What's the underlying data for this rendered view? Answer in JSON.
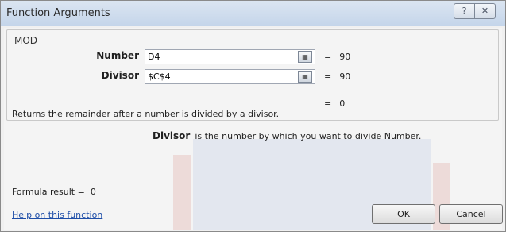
{
  "window": {
    "title": "Function Arguments",
    "help_glyph": "?",
    "close_glyph": "✕"
  },
  "function": {
    "name": "MOD",
    "args": [
      {
        "label": "Number",
        "value": "D4",
        "result_eq": "=",
        "result": "90"
      },
      {
        "label": "Divisor",
        "value": "$C$4",
        "result_eq": "=",
        "result": "90"
      }
    ],
    "overall_eq": "=",
    "overall_result": "0",
    "description": "Returns the remainder after a number is divided by a divisor.",
    "arg_desc_name": "Divisor",
    "arg_desc_text": "is the number by which you want to divide Number."
  },
  "footer": {
    "formula_result_label": "Formula result =",
    "formula_result_value": "0",
    "help_link": "Help on this function",
    "ok_label": "OK",
    "cancel_label": "Cancel"
  },
  "icons": {
    "ref_button": "range-select-icon"
  }
}
